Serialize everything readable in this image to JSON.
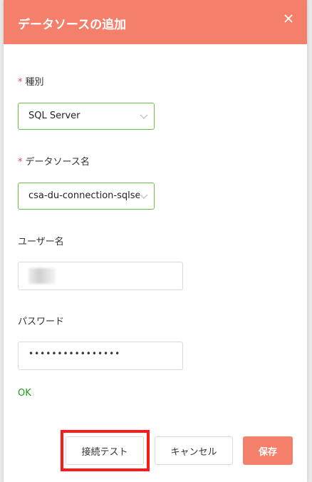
{
  "dialog": {
    "title": "データソースの追加",
    "close_icon": "close-icon"
  },
  "form": {
    "type": {
      "required_mark": "*",
      "label": "種別",
      "value": "SQL Server"
    },
    "datasource_name": {
      "required_mark": "*",
      "label": "データソース名",
      "value": "csa-du-connection-sqlse"
    },
    "username": {
      "label": "ユーザー名"
    },
    "password": {
      "label": "パスワード",
      "value": "••••••••••••••••"
    },
    "status": "OK"
  },
  "buttons": {
    "test": "接続テスト",
    "cancel": "キャンセル",
    "save": "保存"
  },
  "colors": {
    "accent": "#f47f6b",
    "valid_border": "#6dbd45",
    "status_ok": "#1a9a1a",
    "highlight": "#ff1a1a"
  }
}
